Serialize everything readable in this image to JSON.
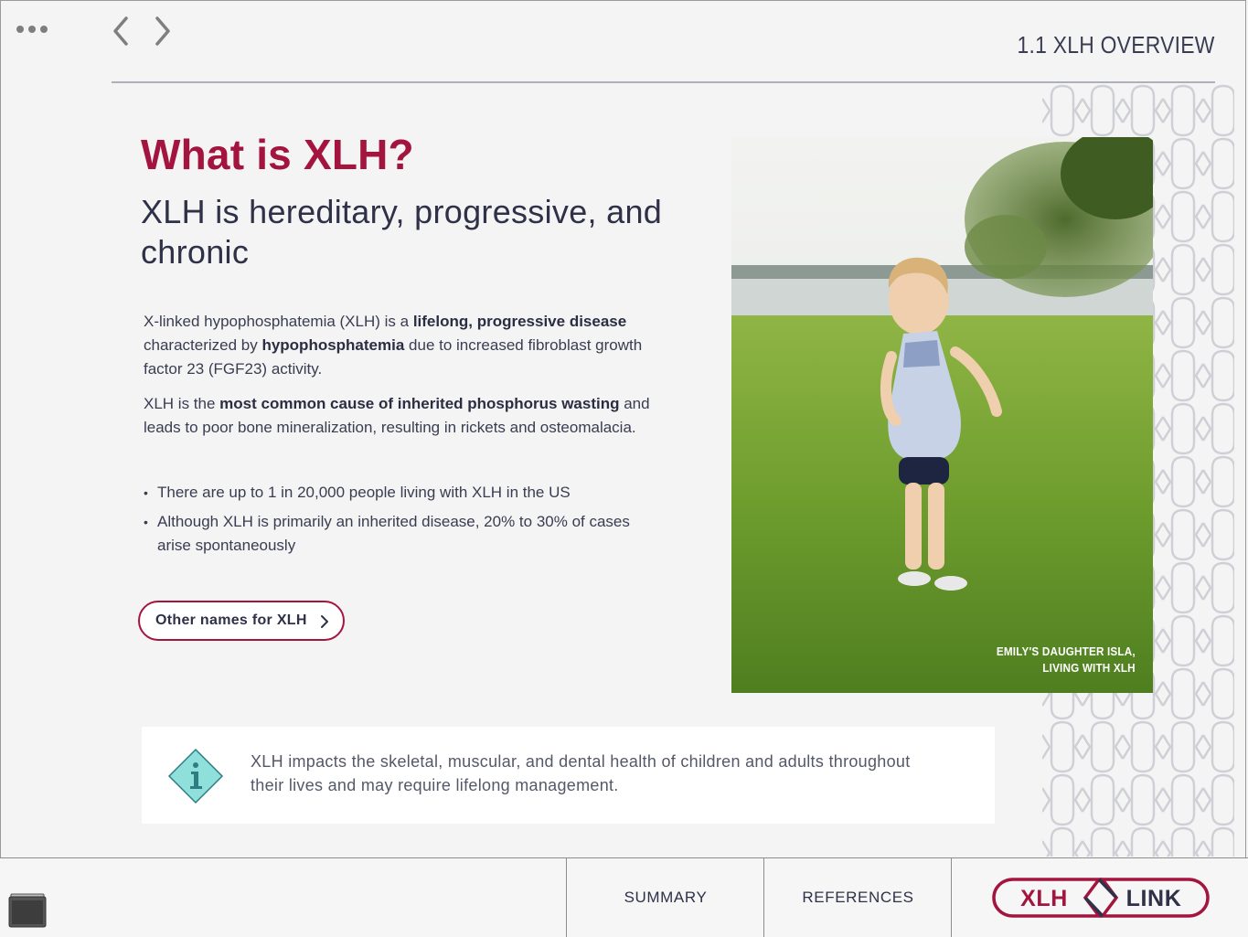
{
  "header": {
    "section_title": "1.1 XLH OVERVIEW"
  },
  "main": {
    "heading": "What is XLH?",
    "subheading": "XLH is hereditary, progressive, and chronic",
    "paragraph1": {
      "t1": "X-linked hypophosphatemia (XLH) is a ",
      "b1": "lifelong, progressive disease",
      "t2": " characterized by ",
      "b2": "hypophosphatemia",
      "t3": " due to increased fibroblast growth factor 23 (FGF23) activity."
    },
    "paragraph2": {
      "t1": "XLH is the ",
      "b1": "most common cause of inherited phosphorus wasting",
      "t2": " and leads to poor bone mineralization, resulting in rickets and osteomalacia."
    },
    "bullets": [
      "There are up to 1 in 20,000 people living with XLH in the US",
      "Although XLH is primarily an inherited disease, 20% to 30% of cases arise spontaneously"
    ],
    "other_names_button": "Other names for XLH"
  },
  "photo": {
    "caption_line1": "EMILY'S DAUGHTER ISLA,",
    "caption_line2": "LIVING WITH XLH"
  },
  "info": {
    "icon": "info-icon",
    "text": "XLH impacts the skeletal, muscular, and dental health of children and adults throughout their lives and may require lifelong management."
  },
  "footer": {
    "summary_label": "SUMMARY",
    "references_label": "REFERENCES",
    "logo_left": "XLH",
    "logo_right": "LINK"
  },
  "colors": {
    "accent": "#a3153f",
    "text_dark": "#2e3147",
    "info_icon_fill": "#8fe0da"
  }
}
